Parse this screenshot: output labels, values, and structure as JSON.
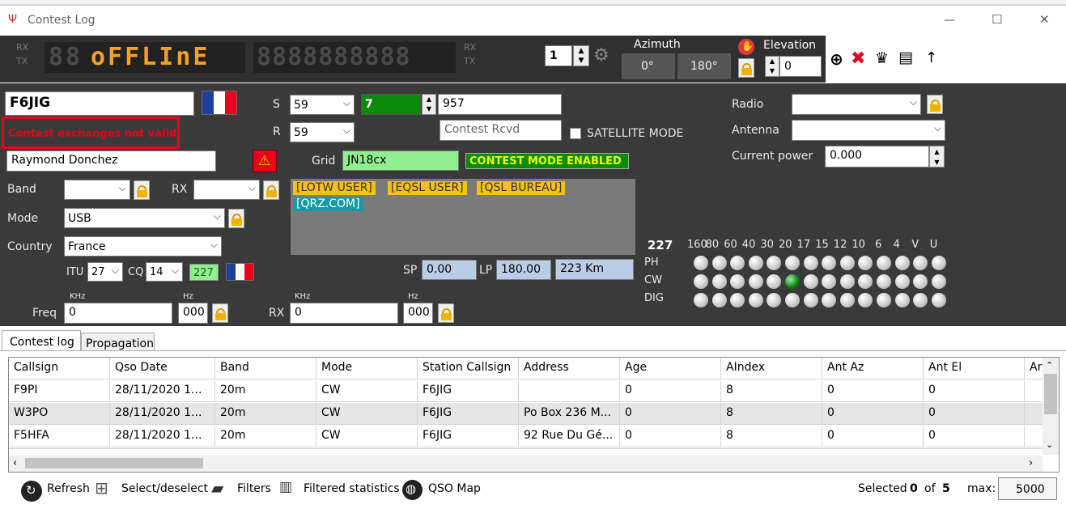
{
  "window": {
    "title": "Contest Log",
    "minimize": "—",
    "maximize": "☐",
    "close": "✕"
  },
  "display": {
    "rx": "RX",
    "tx": "TX",
    "left_digits": "88",
    "status_text": "oFFLInE",
    "right_digits": "8888888888",
    "rx2": "RX",
    "tx2": "TX"
  },
  "top": {
    "channel": "1",
    "azimuth_label": "Azimuth",
    "az_values": [
      "0°",
      "180°"
    ],
    "elevation_label": "Elevation",
    "elevation_value": "0",
    "arrow": "↑"
  },
  "qso": {
    "callsign": "F6JIG",
    "error": "Contest exchanges not valid",
    "name": "Raymond Donchez",
    "s_label": "S",
    "s_value": "59",
    "r_label": "R",
    "r_value": "59",
    "serial": "7",
    "serial_rcvd": "957",
    "contest_rcvd_placeholder": "Contest Rcvd",
    "satellite": "SATELLITE MODE",
    "grid_label": "Grid",
    "grid_value": "JN18cx",
    "contest_mode": "CONTEST MODE ENABLED",
    "tags": [
      "[LOTW USER]",
      "[EQSL USER]",
      "[QSL BUREAU]"
    ],
    "tag_qrz": "[QRZ.COM]"
  },
  "right": {
    "radio_label": "Radio",
    "antenna_label": "Antenna",
    "power_label": "Current power",
    "power_value": "0.000"
  },
  "left": {
    "band_label": "Band",
    "rx_label": "RX",
    "mode_label": "Mode",
    "mode_value": "USB",
    "country_label": "Country",
    "country_value": "France",
    "itu_label": "ITU",
    "itu_value": "27",
    "cq_label": "CQ",
    "cq_value": "14",
    "dxcc": "227"
  },
  "path": {
    "sp_label": "SP",
    "sp_value": "0.00",
    "lp_label": "LP",
    "lp_value": "180.00",
    "distance": "223 Km"
  },
  "freq": {
    "label": "Freq",
    "khz": "KHz",
    "hz": "Hz",
    "value": "0",
    "hz_value": "000",
    "rx_label": "RX",
    "rx_khz": "KHz",
    "rx_hz": "Hz",
    "rx_value": "0",
    "rx_hz_value": "000"
  },
  "bands": {
    "count": "227",
    "labels": [
      "160",
      "80",
      "60",
      "40",
      "30",
      "20",
      "17",
      "15",
      "12",
      "10",
      "6",
      "4",
      "V",
      "U"
    ],
    "rows": [
      "PH",
      "CW",
      "DIG"
    ],
    "worked": {
      "row": 1,
      "col": 5
    }
  },
  "tabs": [
    "Contest log",
    "Propagation"
  ],
  "table": {
    "columns": [
      "Callsign",
      "Qso Date",
      "Band",
      "Mode",
      "Station Callsign",
      "Address",
      "Age",
      "AIndex",
      "Ant Az",
      "Ant El",
      "Ar"
    ],
    "rows": [
      [
        "F9PI",
        "28/11/2020 1...",
        "20m",
        "CW",
        "F6JIG",
        "",
        "0",
        "8",
        "0",
        "0"
      ],
      [
        "W3PO",
        "28/11/2020 1...",
        "20m",
        "CW",
        "F6JIG",
        "Po Box 236 M...",
        "0",
        "8",
        "0",
        "0"
      ],
      [
        "F5HFA",
        "28/11/2020 1...",
        "20m",
        "CW",
        "F6JIG",
        "92 Rue Du Gé...",
        "0",
        "8",
        "0",
        "0"
      ]
    ]
  },
  "status": {
    "refresh": "Refresh",
    "select": "Select/deselect",
    "filters": "Filters",
    "stats": "Filtered statistics",
    "map": "QSO Map",
    "selected_label": "Selected",
    "selected": "0",
    "of": "of",
    "total": "5",
    "max_label": "max:",
    "max": "5000"
  },
  "colors": {
    "accent": "#f3a12a",
    "error": "#e8001c",
    "green": "#0b8a0b"
  }
}
